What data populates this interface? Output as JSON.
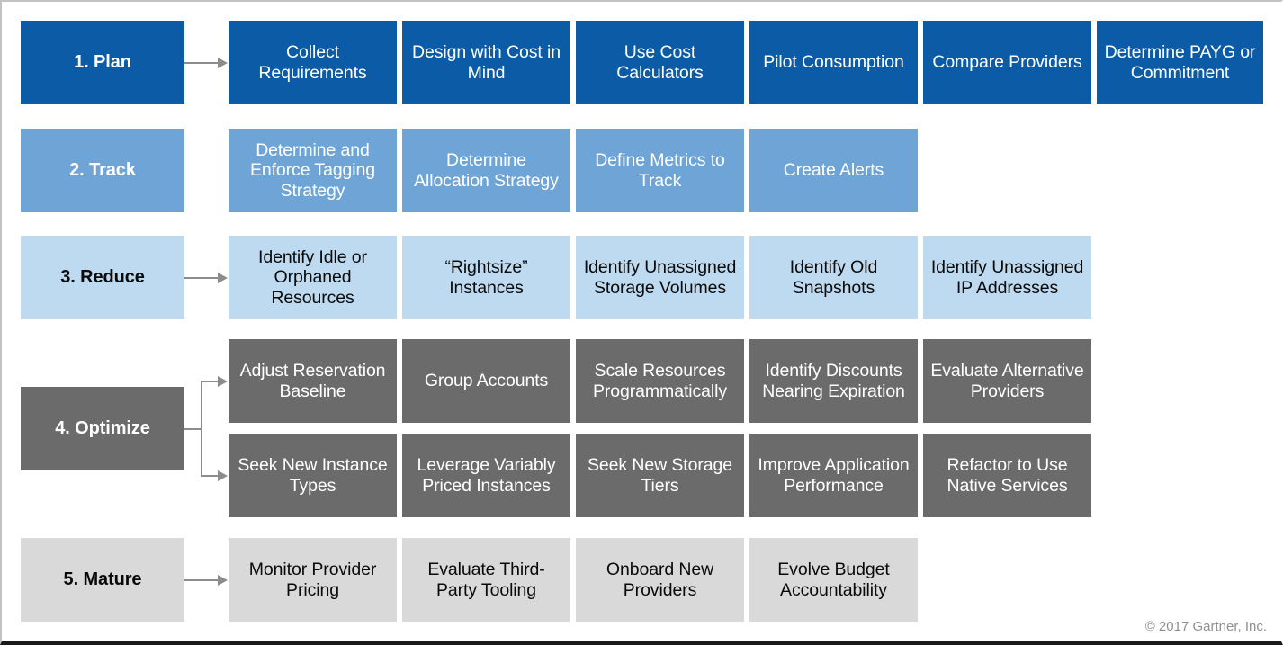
{
  "meta": {
    "copyright": "© 2017 Gartner, Inc."
  },
  "palette": {
    "plan": "#0b5ba6",
    "track": "#6ea5d6",
    "reduce": "#bedaf0",
    "optimize": "#6b6b6b",
    "mature": "#d9d9d9",
    "connector": "#8c8c8c",
    "text_light": "#ffffff",
    "text_dark": "#0a0a0a",
    "copyright_text": "#8f8f8f"
  },
  "rows": [
    {
      "id": "plan",
      "label": "1. Plan",
      "theme": "t-plan",
      "has_arrow": true,
      "arrow_type": "straight",
      "items": [
        "Collect Requirements",
        "Design with Cost in Mind",
        "Use Cost Calculators",
        "Pilot Consumption",
        "Compare Providers",
        "Determine PAYG or Commitment"
      ]
    },
    {
      "id": "track",
      "label": "2. Track",
      "theme": "t-track",
      "has_arrow": false,
      "arrow_type": "none",
      "items": [
        "Determine and Enforce Tagging Strategy",
        "Determine Allocation Strategy",
        "Define Metrics to Track",
        "Create Alerts"
      ]
    },
    {
      "id": "reduce",
      "label": "3. Reduce",
      "theme": "t-reduce",
      "has_arrow": true,
      "arrow_type": "straight",
      "items": [
        "Identify Idle or Orphaned Resources",
        "“Rightsize” Instances",
        "Identify Unassigned Storage Volumes",
        "Identify Old Snapshots",
        "Identify Unassigned IP Addresses"
      ]
    },
    {
      "id": "optimize",
      "label": "4. Optimize",
      "theme": "t-optimize",
      "has_arrow": true,
      "arrow_type": "fork",
      "items_top": [
        "Adjust Reservation Baseline",
        "Group Accounts",
        "Scale Resources Programmatically",
        "Identify Discounts Nearing Expiration",
        "Evaluate Alternative Providers"
      ],
      "items_bottom": [
        "Seek New Instance Types",
        "Leverage Variably Priced Instances",
        "Seek New Storage Tiers",
        "Improve Application Performance",
        "Refactor to Use Native Services"
      ]
    },
    {
      "id": "mature",
      "label": "5. Mature",
      "theme": "t-mature",
      "has_arrow": true,
      "arrow_type": "straight",
      "items": [
        "Monitor Provider Pricing",
        "Evaluate Third-Party Tooling",
        "Onboard New Providers",
        "Evolve Budget Accountability"
      ]
    }
  ]
}
